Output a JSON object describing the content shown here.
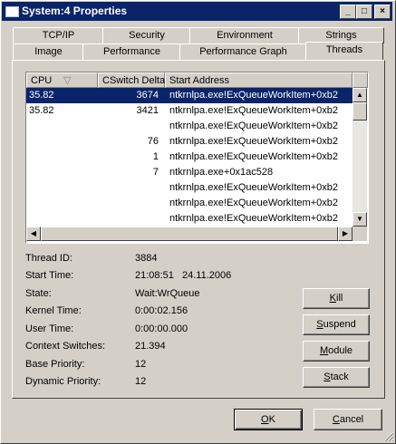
{
  "window": {
    "title": "System:4 Properties",
    "minimize": "_",
    "maximize": "□",
    "close": "×"
  },
  "tabs_back": [
    "TCP/IP",
    "Security",
    "Environment",
    "Strings"
  ],
  "tabs_front": [
    "Image",
    "Performance",
    "Performance Graph",
    "Threads"
  ],
  "list": {
    "columns": [
      "CPU",
      "CSwitch Delta",
      "Start Address"
    ],
    "sort_indicator": "▽",
    "rows": [
      {
        "cpu": "35.82",
        "delta": "3674",
        "address": "ntkrnlpa.exe!ExQueueWorkItem+0xb2",
        "selected": true
      },
      {
        "cpu": "35.82",
        "delta": "3421",
        "address": "ntkrnlpa.exe!ExQueueWorkItem+0xb2",
        "selected": false
      },
      {
        "cpu": "",
        "delta": "",
        "address": "ntkrnlpa.exe!ExQueueWorkItem+0xb2",
        "selected": false
      },
      {
        "cpu": "",
        "delta": "76",
        "address": "ntkrnlpa.exe!ExQueueWorkItem+0xb2",
        "selected": false
      },
      {
        "cpu": "",
        "delta": "1",
        "address": "ntkrnlpa.exe!ExQueueWorkItem+0xb2",
        "selected": false
      },
      {
        "cpu": "",
        "delta": "7",
        "address": "ntkrnlpa.exe+0x1ac528",
        "selected": false
      },
      {
        "cpu": "",
        "delta": "",
        "address": "ntkrnlpa.exe!ExQueueWorkItem+0xb2",
        "selected": false
      },
      {
        "cpu": "",
        "delta": "",
        "address": "ntkrnlpa.exe!ExQueueWorkItem+0xb2",
        "selected": false
      },
      {
        "cpu": "",
        "delta": "",
        "address": "ntkrnlpa.exe!ExQueueWorkItem+0xb2",
        "selected": false
      }
    ]
  },
  "details": {
    "thread_id_label": "Thread ID:",
    "thread_id": "3884",
    "start_time_label": "Start Time:",
    "start_time": "21:08:51   24.11.2006",
    "state_label": "State:",
    "state": "Wait:WrQueue",
    "kernel_time_label": "Kernel Time:",
    "kernel_time": "0:00:02.156",
    "user_time_label": "User Time:",
    "user_time": "0:00:00.000",
    "context_switches_label": "Context Switches:",
    "context_switches": "21.394",
    "base_priority_label": "Base Priority:",
    "base_priority": "12",
    "dynamic_priority_label": "Dynamic Priority:",
    "dynamic_priority": "12"
  },
  "actions": {
    "kill": "Kill",
    "suspend": "Suspend",
    "module": "Module",
    "stack": "Stack"
  },
  "footer": {
    "ok": "OK",
    "cancel": "Cancel"
  },
  "colors": {
    "title_bar": "#0a246a",
    "selection": "#0a246a",
    "face": "#d4d0c8"
  }
}
